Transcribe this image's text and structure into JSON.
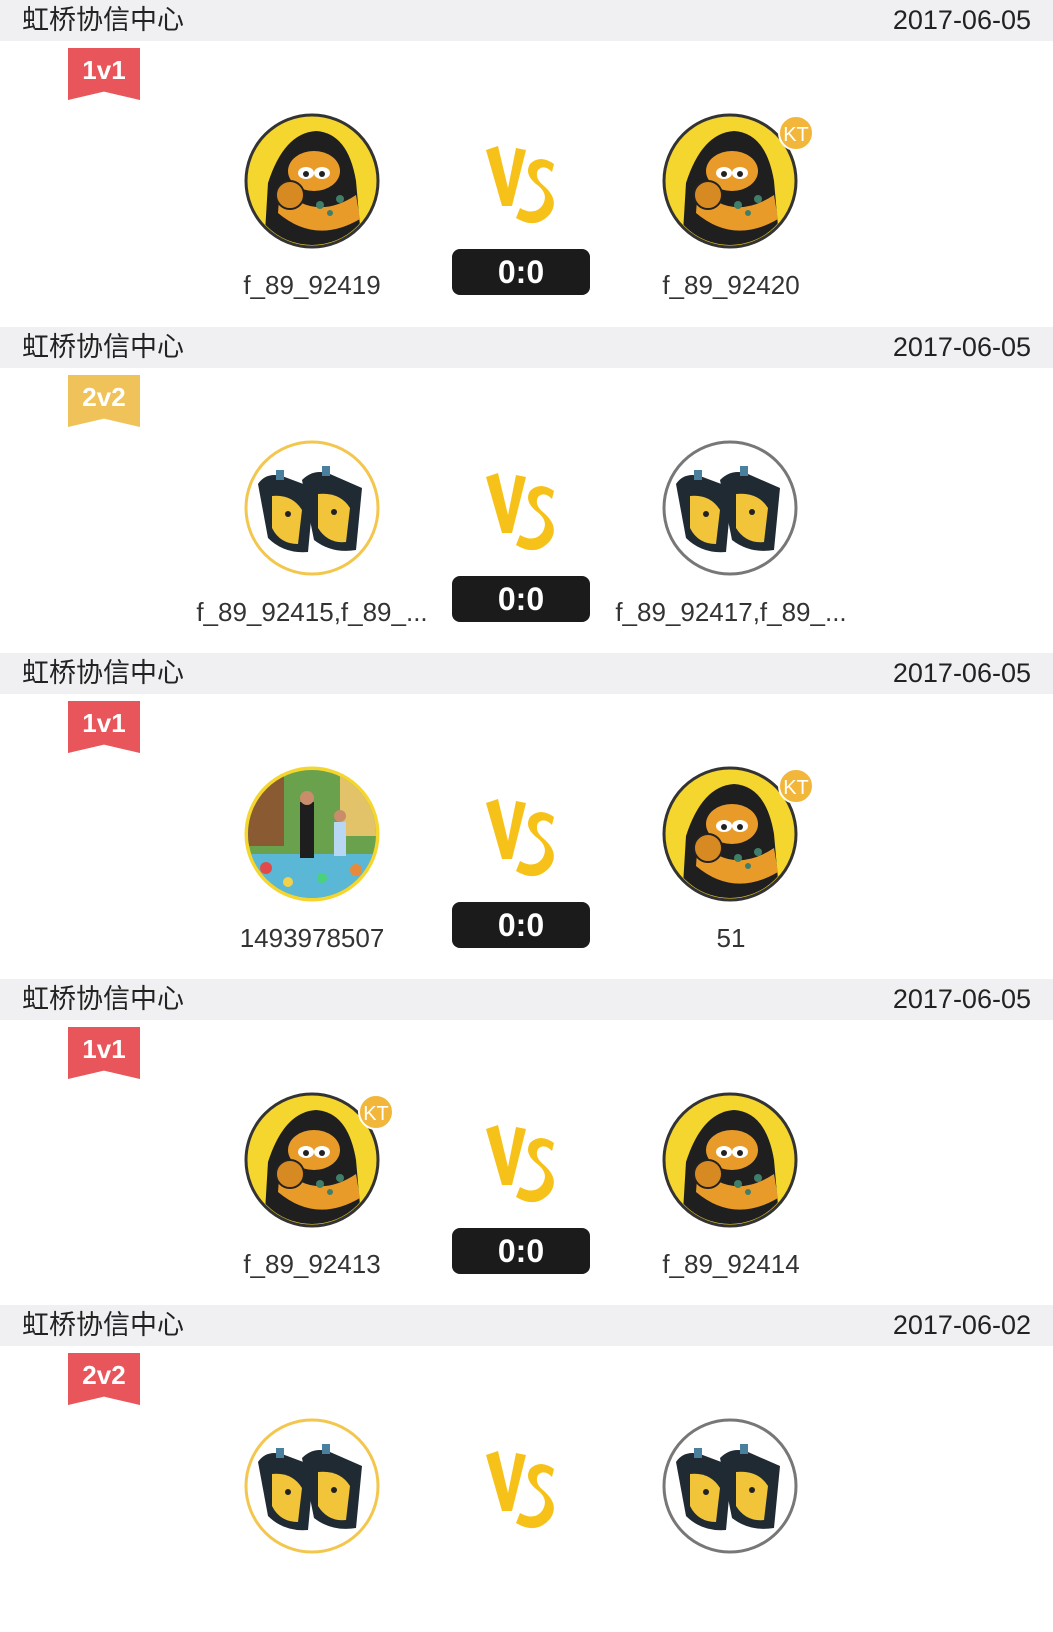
{
  "matches": [
    {
      "venue": "虹桥协信中心",
      "date": "2017-06-05",
      "mode": "1v1",
      "mode_color": "red",
      "score": "0:0",
      "left": {
        "name": "f_89_92419",
        "avatar": "tiger-icon",
        "kt": false
      },
      "right": {
        "name": "f_89_92420",
        "avatar": "tiger-icon",
        "kt": true,
        "kt_label": "KT"
      }
    },
    {
      "venue": "虹桥协信中心",
      "date": "2017-06-05",
      "mode": "2v2",
      "mode_color": "gold",
      "score": "0:0",
      "left": {
        "name": "f_89_92415,f_89_...",
        "avatar": "team-icon",
        "kt": false
      },
      "right": {
        "name": "f_89_92417,f_89_...",
        "avatar": "team-icon",
        "kt": false
      }
    },
    {
      "venue": "虹桥协信中心",
      "date": "2017-06-05",
      "mode": "1v1",
      "mode_color": "red",
      "score": "0:0",
      "left": {
        "name": "1493978507",
        "avatar": "photo-avatar",
        "kt": false
      },
      "right": {
        "name": "51",
        "avatar": "tiger-icon",
        "kt": true,
        "kt_label": "KT"
      }
    },
    {
      "venue": "虹桥协信中心",
      "date": "2017-06-05",
      "mode": "1v1",
      "mode_color": "red",
      "score": "0:0",
      "left": {
        "name": "f_89_92413",
        "avatar": "tiger-icon",
        "kt": true,
        "kt_label": "KT"
      },
      "right": {
        "name": "f_89_92414",
        "avatar": "tiger-icon",
        "kt": false
      }
    },
    {
      "venue": "虹桥协信中心",
      "date": "2017-06-02",
      "mode": "2v2",
      "mode_color": "red",
      "score": "",
      "left": {
        "name": "",
        "avatar": "team-icon",
        "kt": false
      },
      "right": {
        "name": "",
        "avatar": "team-icon",
        "kt": false
      }
    }
  ],
  "vs_label": "VS",
  "colors": {
    "header_bg": "#f0f0f2",
    "ribbon_red": "#e8565b",
    "ribbon_gold": "#f0c35a",
    "vs_yellow": "#f6c21a",
    "kt_badge": "#f2b63b",
    "score_bg": "#1b1b1b"
  }
}
